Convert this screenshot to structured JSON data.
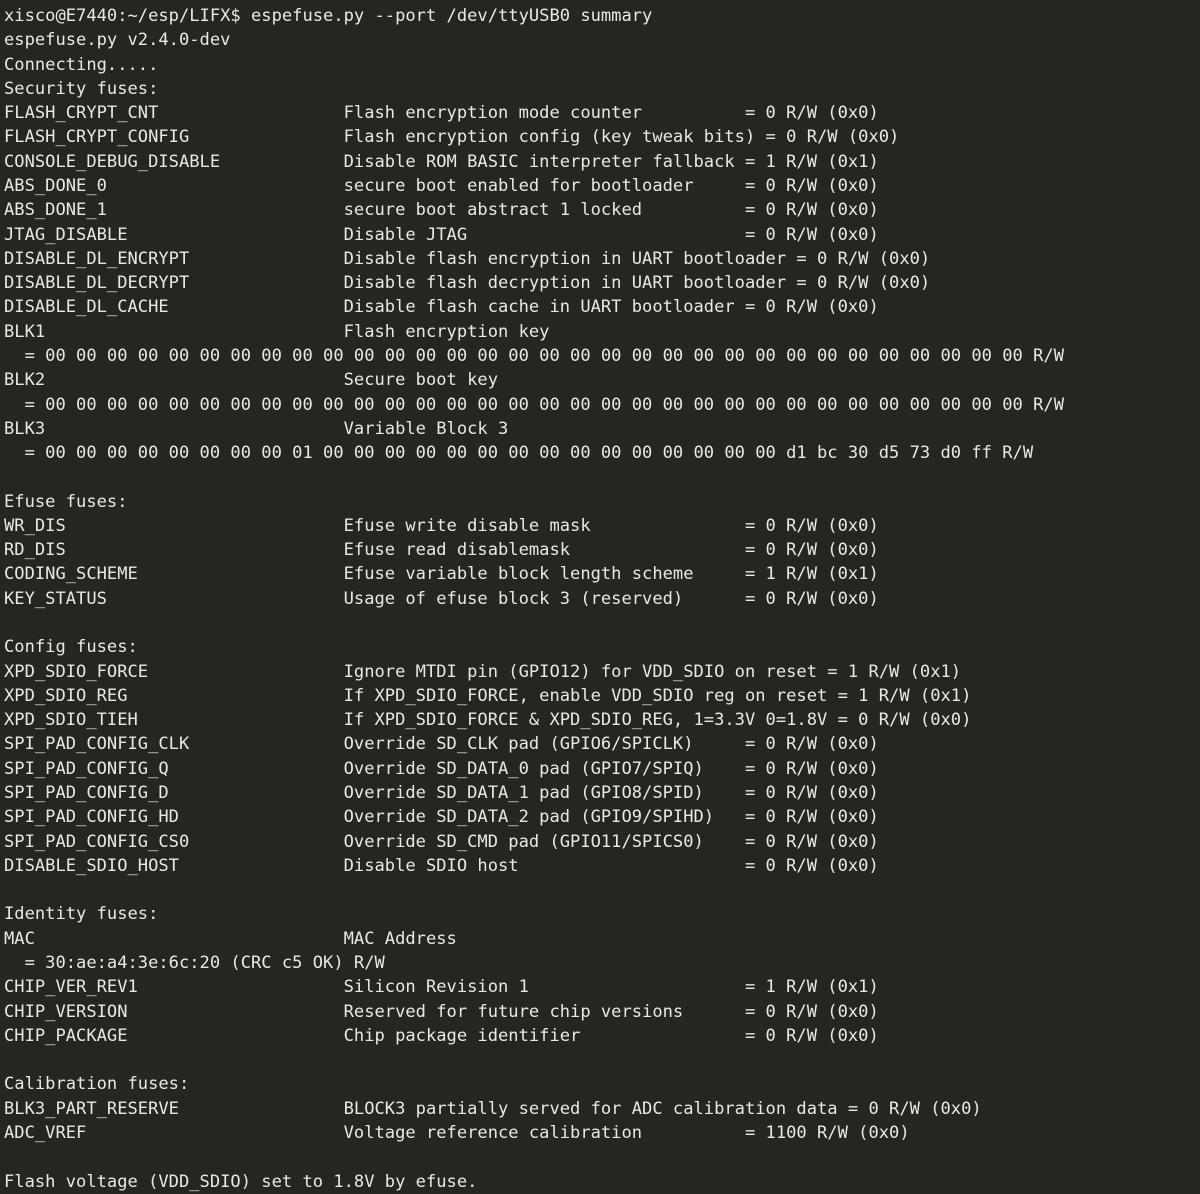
{
  "terminal": {
    "colors": {
      "background": "#262621",
      "foreground": "#e9e9e3"
    },
    "prompt": {
      "user_host": "xisco@E7440",
      "cwd": "~/esp/LIFX",
      "symbol": "$",
      "command": "espefuse.py --port /dev/ttyUSB0 summary",
      "full_line": "xisco@E7440:~/esp/LIFX$ espefuse.py --port /dev/ttyUSB0 summary"
    },
    "program": {
      "version_line": "espefuse.py v2.4.0-dev",
      "connecting_line": "Connecting....."
    },
    "footer_line": "Flash voltage (VDD_SDIO) set to 1.8V by efuse.",
    "sections": [
      {
        "heading": "Security fuses:",
        "rows": [
          {
            "name": "FLASH_CRYPT_CNT",
            "description": "Flash encryption mode counter",
            "value": "= 0 R/W (0x0)"
          },
          {
            "name": "FLASH_CRYPT_CONFIG",
            "description": "Flash encryption config (key tweak bits)",
            "value": "= 0 R/W (0x0)"
          },
          {
            "name": "CONSOLE_DEBUG_DISABLE",
            "description": "Disable ROM BASIC interpreter fallback",
            "value": "= 1 R/W (0x1)"
          },
          {
            "name": "ABS_DONE_0",
            "description": "secure boot enabled for bootloader",
            "value": "= 0 R/W (0x0)"
          },
          {
            "name": "ABS_DONE_1",
            "description": "secure boot abstract 1 locked",
            "value": "= 0 R/W (0x0)"
          },
          {
            "name": "JTAG_DISABLE",
            "description": "Disable JTAG",
            "value": "= 0 R/W (0x0)"
          },
          {
            "name": "DISABLE_DL_ENCRYPT",
            "description": "Disable flash encryption in UART bootloader",
            "value": "= 0 R/W (0x0)"
          },
          {
            "name": "DISABLE_DL_DECRYPT",
            "description": "Disable flash decryption in UART bootloader",
            "value": "= 0 R/W (0x0)"
          },
          {
            "name": "DISABLE_DL_CACHE",
            "description": "Disable flash cache in UART bootloader",
            "value": "= 0 R/W (0x0)"
          },
          {
            "name": "BLK1",
            "description": "Flash encryption key",
            "value": "",
            "hex_line": "  = 00 00 00 00 00 00 00 00 00 00 00 00 00 00 00 00 00 00 00 00 00 00 00 00 00 00 00 00 00 00 00 00 R/W"
          },
          {
            "name": "BLK2",
            "description": "Secure boot key",
            "value": "",
            "hex_line": "  = 00 00 00 00 00 00 00 00 00 00 00 00 00 00 00 00 00 00 00 00 00 00 00 00 00 00 00 00 00 00 00 00 R/W"
          },
          {
            "name": "BLK3",
            "description": "Variable Block 3",
            "value": "",
            "hex_line": "  = 00 00 00 00 00 00 00 00 01 00 00 00 00 00 00 00 00 00 00 00 00 00 00 00 d1 bc 30 d5 73 d0 ff R/W"
          }
        ]
      },
      {
        "heading": "Efuse fuses:",
        "rows": [
          {
            "name": "WR_DIS",
            "description": "Efuse write disable mask",
            "value": "= 0 R/W (0x0)"
          },
          {
            "name": "RD_DIS",
            "description": "Efuse read disablemask",
            "value": "= 0 R/W (0x0)"
          },
          {
            "name": "CODING_SCHEME",
            "description": "Efuse variable block length scheme",
            "value": "= 1 R/W (0x1)"
          },
          {
            "name": "KEY_STATUS",
            "description": "Usage of efuse block 3 (reserved)",
            "value": "= 0 R/W (0x0)"
          }
        ]
      },
      {
        "heading": "Config fuses:",
        "rows": [
          {
            "name": "XPD_SDIO_FORCE",
            "description": "Ignore MTDI pin (GPIO12) for VDD_SDIO on reset",
            "value": "= 1 R/W (0x1)"
          },
          {
            "name": "XPD_SDIO_REG",
            "description": "If XPD_SDIO_FORCE, enable VDD_SDIO reg on reset",
            "value": "= 1 R/W (0x1)"
          },
          {
            "name": "XPD_SDIO_TIEH",
            "description": "If XPD_SDIO_FORCE & XPD_SDIO_REG, 1=3.3V 0=1.8V",
            "value": "= 0 R/W (0x0)"
          },
          {
            "name": "SPI_PAD_CONFIG_CLK",
            "description": "Override SD_CLK pad (GPIO6/SPICLK)",
            "value": "= 0 R/W (0x0)"
          },
          {
            "name": "SPI_PAD_CONFIG_Q",
            "description": "Override SD_DATA_0 pad (GPIO7/SPIQ)",
            "value": "= 0 R/W (0x0)"
          },
          {
            "name": "SPI_PAD_CONFIG_D",
            "description": "Override SD_DATA_1 pad (GPIO8/SPID)",
            "value": "= 0 R/W (0x0)"
          },
          {
            "name": "SPI_PAD_CONFIG_HD",
            "description": "Override SD_DATA_2 pad (GPIO9/SPIHD)",
            "value": "= 0 R/W (0x0)"
          },
          {
            "name": "SPI_PAD_CONFIG_CS0",
            "description": "Override SD_CMD pad (GPIO11/SPICS0)",
            "value": "= 0 R/W (0x0)"
          },
          {
            "name": "DISABLE_SDIO_HOST",
            "description": "Disable SDIO host",
            "value": "= 0 R/W (0x0)"
          }
        ]
      },
      {
        "heading": "Identity fuses:",
        "rows": [
          {
            "name": "MAC",
            "description": "MAC Address",
            "value": "",
            "hex_line": "  = 30:ae:a4:3e:6c:20 (CRC c5 OK) R/W"
          },
          {
            "name": "CHIP_VER_REV1",
            "description": "Silicon Revision 1",
            "value": "= 1 R/W (0x1)"
          },
          {
            "name": "CHIP_VERSION",
            "description": "Reserved for future chip versions",
            "value": "= 0 R/W (0x0)"
          },
          {
            "name": "CHIP_PACKAGE",
            "description": "Chip package identifier",
            "value": "= 0 R/W (0x0)"
          }
        ]
      },
      {
        "heading": "Calibration fuses:",
        "rows": [
          {
            "name": "BLK3_PART_RESERVE",
            "description": "BLOCK3 partially served for ADC calibration data",
            "value": "= 0 R/W (0x0)"
          },
          {
            "name": "ADC_VREF",
            "description": "Voltage reference calibration",
            "value": "= 1100 R/W (0x0)"
          }
        ]
      }
    ]
  }
}
